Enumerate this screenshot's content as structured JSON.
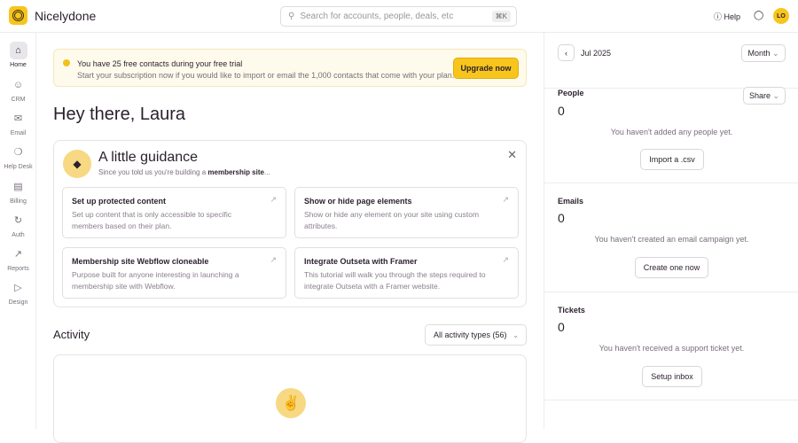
{
  "header": {
    "brand": "Nicelydone",
    "search_placeholder": "Search for accounts, people, deals, etc",
    "search_shortcut": "⌘K",
    "help": "Help",
    "avatar": "LO"
  },
  "sidebar": {
    "items": [
      {
        "label": "Home",
        "icon": "⌂"
      },
      {
        "label": "CRM",
        "icon": "☺"
      },
      {
        "label": "Email",
        "icon": "✉"
      },
      {
        "label": "Help Desk",
        "icon": "❍"
      },
      {
        "label": "Billing",
        "icon": "▤"
      },
      {
        "label": "Auth",
        "icon": "↻"
      },
      {
        "label": "Reports",
        "icon": "↗"
      },
      {
        "label": "Design",
        "icon": "▷"
      }
    ]
  },
  "banner": {
    "title": "You have 25 free contacts during your free trial",
    "text": "Start your subscription now if you would like to import or email the 1,000 contacts that come with your plan.",
    "button": "Upgrade now"
  },
  "greeting": "Hey there, Laura",
  "guidance": {
    "title": "A little guidance",
    "subtitle_pre": "Since you told us you're building a ",
    "subtitle_bold": "membership site",
    "subtitle_post": "...",
    "cards": [
      {
        "title": "Set up protected content",
        "desc": "Set up content that is only accessible to specific members based on their plan."
      },
      {
        "title": "Show or hide page elements",
        "desc": "Show or hide any element on your site using custom attributes."
      },
      {
        "title": "Membership site Webflow cloneable",
        "desc": "Purpose built for anyone interesting in launching a membership site with Webflow."
      },
      {
        "title": "Integrate Outseta with Framer",
        "desc": "This tutorial will walk you through the steps required to integrate Outseta with a Framer website."
      }
    ]
  },
  "activity": {
    "title": "Activity",
    "filter": "All activity types (56)"
  },
  "right": {
    "month": "Jul 2025",
    "period": "Month",
    "share": "Share",
    "people": {
      "label": "People",
      "count": "0",
      "msg": "You haven't added any people yet.",
      "button": "Import a .csv"
    },
    "emails": {
      "label": "Emails",
      "count": "0",
      "msg": "You haven't created an email campaign yet.",
      "button": "Create one now"
    },
    "tickets": {
      "label": "Tickets",
      "count": "0",
      "msg": "You haven't received a support ticket yet.",
      "button": "Setup inbox"
    }
  }
}
